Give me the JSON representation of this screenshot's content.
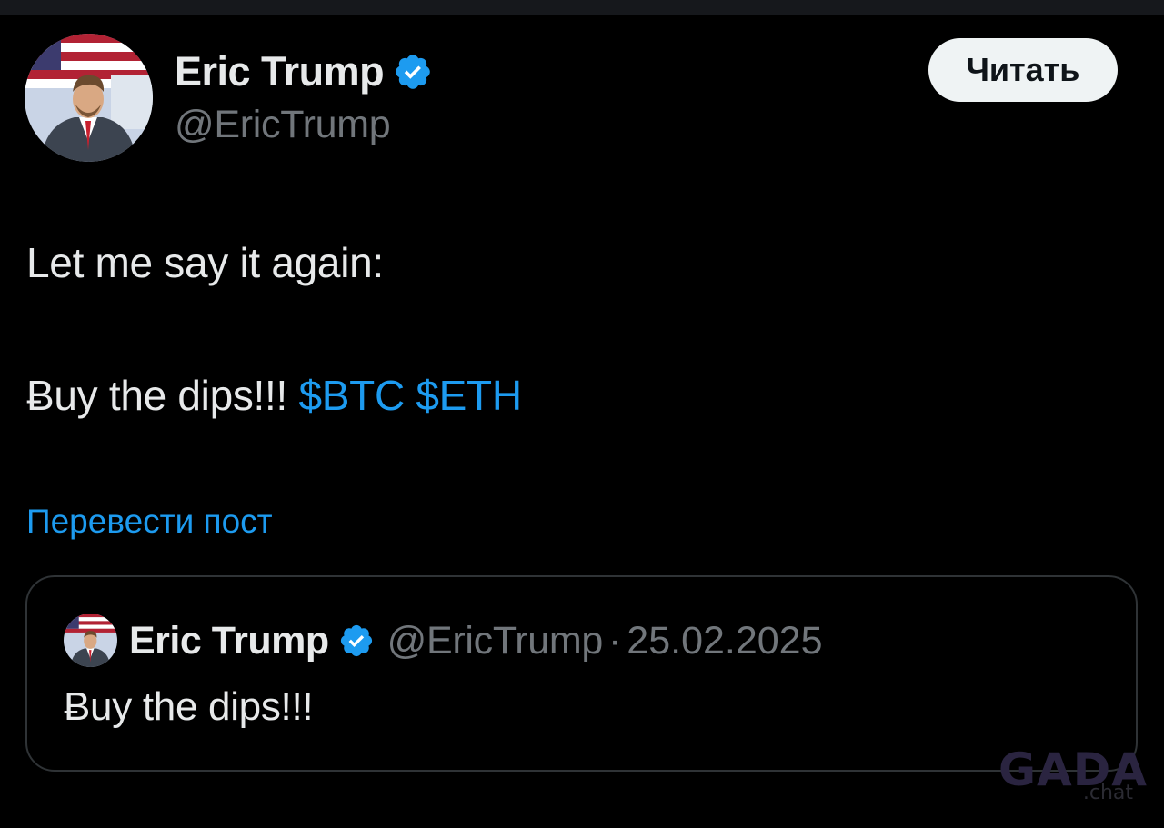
{
  "post": {
    "author": {
      "display_name": "Eric Trump",
      "handle": "@EricTrump",
      "verified_icon": "verified-badge-icon",
      "avatar_icon": "profile-avatar"
    },
    "follow_button_label": "Читать",
    "text_line1": "Let me say it again:",
    "text_line2": "Ƀuy the dips!!! ",
    "cashtags": [
      "$BTC",
      "$ETH"
    ],
    "translate_label": "Перевести пост"
  },
  "quote": {
    "display_name": "Eric Trump",
    "handle": "@EricTrump",
    "separator": "·",
    "date": "25.02.2025",
    "text": "Ƀuy the dips!!!"
  },
  "watermark": {
    "main": "GADA",
    "sub": ".chat"
  },
  "colors": {
    "background": "#000000",
    "text": "#e7e9ea",
    "secondary": "#71767b",
    "accent": "#1d9bf0",
    "border": "#2f3336",
    "button_bg": "#eff3f4"
  }
}
